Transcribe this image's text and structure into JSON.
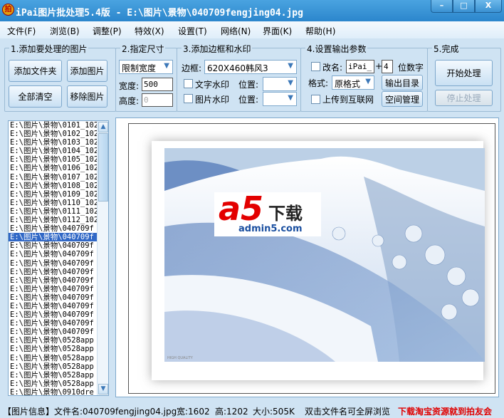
{
  "window": {
    "title": "iPai图片批处理5.4版 - E:\\图片\\景物\\040709fengjing04.jpg",
    "app_icon": "拍",
    "minimize": "–",
    "maximize": "□",
    "close": "X"
  },
  "menu": [
    "文件(F)",
    "浏览(B)",
    "调整(P)",
    "特效(X)",
    "设置(T)",
    "网络(N)",
    "界面(K)",
    "帮助(H)"
  ],
  "group1": {
    "label": "1.添加要处理的图片",
    "add_folder": "添加文件夹",
    "add_image": "添加图片",
    "clear_all": "全部清空",
    "remove_image": "移除图片"
  },
  "group2": {
    "label": "2.指定尺寸",
    "mode": "限制宽度",
    "width_label": "宽度:",
    "width_value": "500",
    "height_label": "高度:",
    "height_value": "0"
  },
  "group3": {
    "label": "3.添加边框和水印",
    "border_label": "边框:",
    "border_value": "620X460韩风3",
    "text_wm": "文字水印",
    "image_wm": "图片水印",
    "pos_label": "位置:"
  },
  "group4": {
    "label": "4.设置输出参数",
    "rename": "改名:",
    "prefix": "iPai_",
    "plus": "+",
    "digits": "4",
    "digits_label": "位数字",
    "format_label": "格式:",
    "format_value": "原格式",
    "output_dir": "输出目录",
    "upload": "上传到互联网",
    "space_mgmt": "空间管理"
  },
  "group5": {
    "label": "5.完成",
    "start": "开始处理",
    "stop": "停止处理"
  },
  "files": [
    "E:\\图片\\景物\\0101_102",
    "E:\\图片\\景物\\0102_102",
    "E:\\图片\\景物\\0103_102",
    "E:\\图片\\景物\\0104_102",
    "E:\\图片\\景物\\0105_102",
    "E:\\图片\\景物\\0106_102",
    "E:\\图片\\景物\\0107_102",
    "E:\\图片\\景物\\0108_102",
    "E:\\图片\\景物\\0109_102",
    "E:\\图片\\景物\\0110_102",
    "E:\\图片\\景物\\0111_102",
    "E:\\图片\\景物\\0112_102",
    "E:\\图片\\景物\\040709f",
    "E:\\图片\\景物\\040709f",
    "E:\\图片\\景物\\040709f",
    "E:\\图片\\景物\\040709f",
    "E:\\图片\\景物\\040709f",
    "E:\\图片\\景物\\040709f",
    "E:\\图片\\景物\\040709f",
    "E:\\图片\\景物\\040709f",
    "E:\\图片\\景物\\040709f",
    "E:\\图片\\景物\\040709f",
    "E:\\图片\\景物\\040709f",
    "E:\\图片\\景物\\040709f",
    "E:\\图片\\景物\\040709f",
    "E:\\图片\\景物\\0528app",
    "E:\\图片\\景物\\0528app",
    "E:\\图片\\景物\\0528app",
    "E:\\图片\\景物\\0528app",
    "E:\\图片\\景物\\0528app",
    "E:\\图片\\景物\\0528app",
    "E:\\图片\\景物\\0910dre"
  ],
  "selected_index": 13,
  "preview": {
    "logo_main": "a5下载",
    "logo_sub": "admin5.com",
    "photo_caption": "HIGH QUALITY"
  },
  "status": {
    "info": "【图片信息】文件名:040709fengjing04.jpg",
    "width": "宽:1602",
    "height": "高:1202",
    "size": "大小:505K",
    "hint": "双击文件名可全屏浏览",
    "promo": "下载淘宝资源就到拍友会",
    "promo_color": "#e00000"
  }
}
